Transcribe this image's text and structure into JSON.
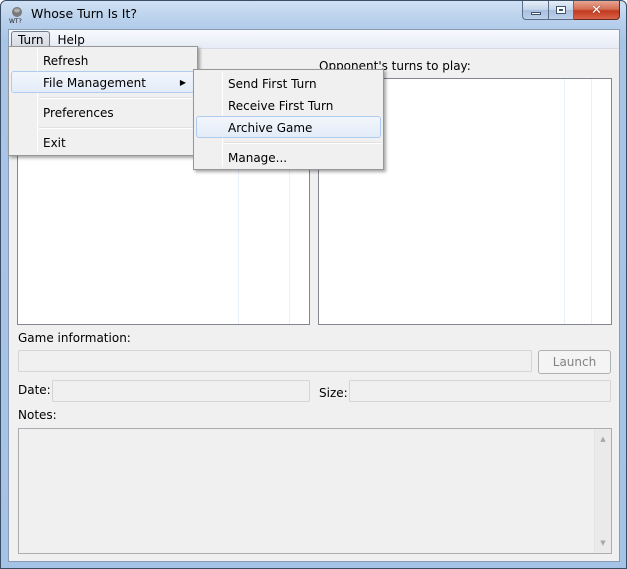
{
  "window": {
    "title": "Whose Turn Is It?",
    "icon": "wti-app-icon",
    "caption_buttons": [
      "minimize",
      "maximize",
      "close"
    ]
  },
  "menubar": {
    "items": [
      {
        "label": "Turn",
        "active": true
      },
      {
        "label": "Help",
        "active": false
      }
    ]
  },
  "turn_menu": {
    "items": [
      {
        "label": "Refresh"
      },
      {
        "label": "File Management",
        "has_submenu": true,
        "highlighted": true
      },
      {
        "label": "Preferences"
      },
      {
        "label": "Exit"
      }
    ]
  },
  "file_management_submenu": {
    "items": [
      {
        "label": "Send First Turn"
      },
      {
        "label": "Receive First Turn"
      },
      {
        "label": "Archive Game",
        "highlighted": true
      },
      {
        "label": "Manage..."
      }
    ]
  },
  "main": {
    "opponent_turns_label": "Opponent's turns to play:",
    "game_info_label": "Game information:",
    "game_info_value": "",
    "launch_button": "Launch",
    "date_label": "Date:",
    "date_value": "",
    "size_label": "Size:",
    "size_value": "",
    "notes_label": "Notes:",
    "notes_value": ""
  },
  "icons": {
    "submenu_arrow": "▶",
    "close": "✕",
    "scroll_up": "▲",
    "scroll_down": "▼"
  }
}
